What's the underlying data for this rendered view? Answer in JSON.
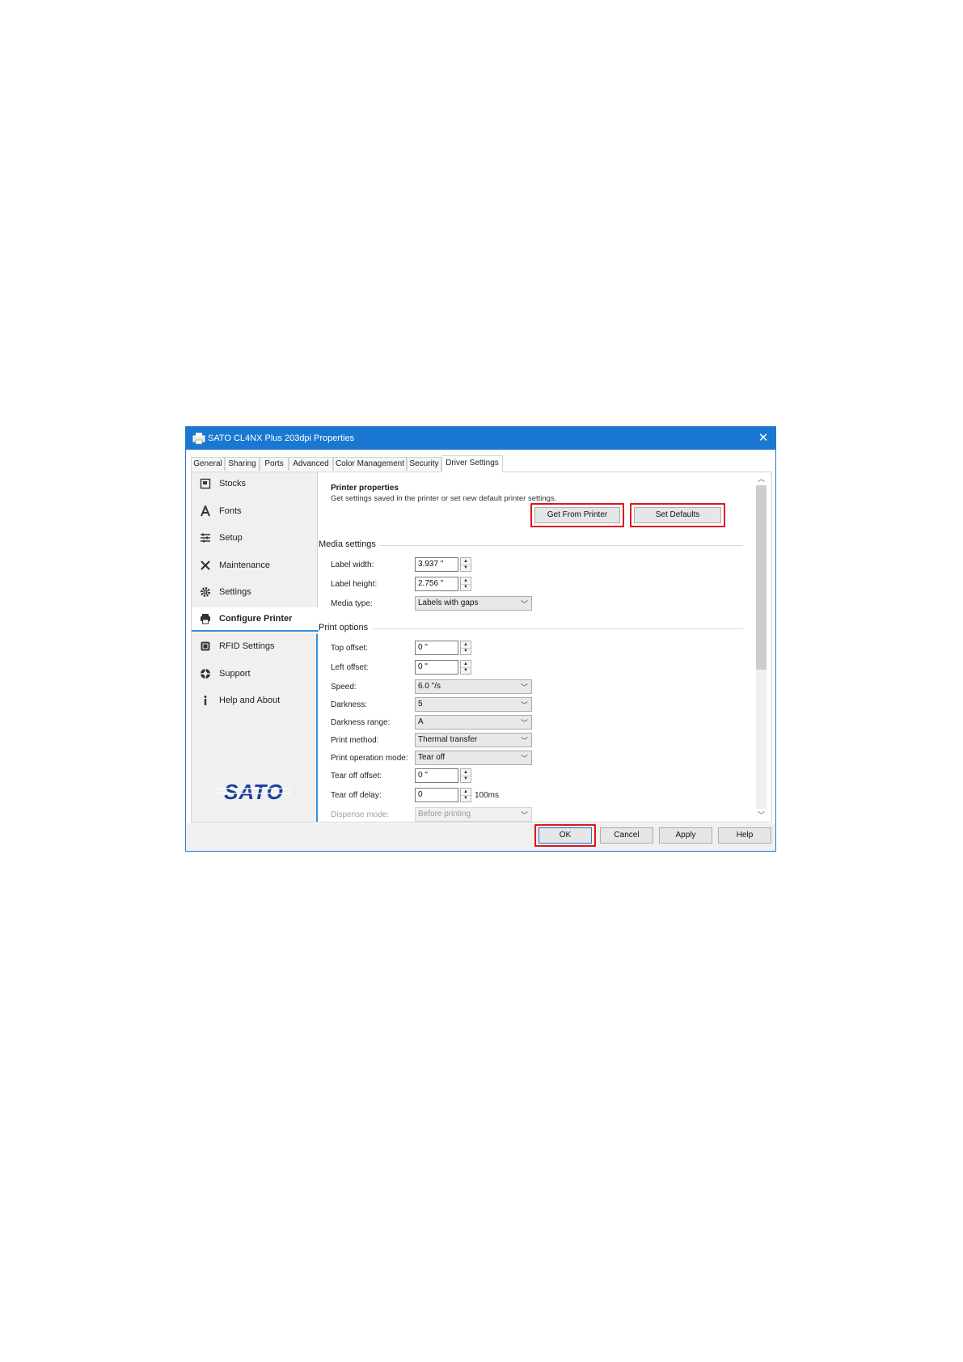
{
  "window": {
    "title": "SATO CL4NX Plus 203dpi Properties",
    "close": "✕"
  },
  "tabs": [
    {
      "label": "General"
    },
    {
      "label": "Sharing"
    },
    {
      "label": "Ports"
    },
    {
      "label": "Advanced"
    },
    {
      "label": "Color Management"
    },
    {
      "label": "Security"
    },
    {
      "label": "Driver Settings",
      "active": true
    }
  ],
  "sidebar": {
    "items": [
      {
        "label": "Stocks",
        "icon": "stocks-icon"
      },
      {
        "label": "Fonts",
        "icon": "fonts-icon"
      },
      {
        "label": "Setup",
        "icon": "setup-icon"
      },
      {
        "label": "Maintenance",
        "icon": "maintenance-icon"
      },
      {
        "label": "Settings",
        "icon": "gear-icon"
      },
      {
        "label": "Configure Printer",
        "icon": "printer-icon",
        "active": true
      },
      {
        "label": "RFID Settings",
        "icon": "rfid-icon"
      },
      {
        "label": "Support",
        "icon": "support-icon"
      },
      {
        "label": "Help and About",
        "icon": "info-icon"
      }
    ],
    "logo_text": "SATO"
  },
  "printer_properties": {
    "heading": "Printer properties",
    "description": "Get settings saved in the printer or set new default printer settings.",
    "get_from_printer": "Get From Printer",
    "set_defaults": "Set Defaults"
  },
  "media_settings": {
    "title": "Media settings",
    "label_width_label": "Label width:",
    "label_width_value": "3.937 \"",
    "label_height_label": "Label height:",
    "label_height_value": "2.756 \"",
    "media_type_label": "Media type:",
    "media_type_value": "Labels with gaps"
  },
  "print_options": {
    "title": "Print options",
    "top_offset_label": "Top offset:",
    "top_offset_value": "0 \"",
    "left_offset_label": "Left offset:",
    "left_offset_value": "0 \"",
    "speed_label": "Speed:",
    "speed_value": "6.0 \"/s",
    "darkness_label": "Darkness:",
    "darkness_value": "5",
    "darkness_range_label": "Darkness range:",
    "darkness_range_value": "A",
    "print_method_label": "Print method:",
    "print_method_value": "Thermal transfer",
    "print_operation_mode_label": "Print operation mode:",
    "print_operation_mode_value": "Tear off",
    "tear_off_offset_label": "Tear off offset:",
    "tear_off_offset_value": "0 \"",
    "tear_off_delay_label": "Tear off delay:",
    "tear_off_delay_value": "0",
    "tear_off_delay_unit": "100ms",
    "dispense_mode_label": "Dispense mode:",
    "dispense_mode_value": "Before printing"
  },
  "footer": {
    "ok": "OK",
    "cancel": "Cancel",
    "apply": "Apply",
    "help": "Help"
  },
  "colors": {
    "titlebar": "#1a78d2",
    "highlight": "#e0141e",
    "logo": "#1c3f9a"
  }
}
